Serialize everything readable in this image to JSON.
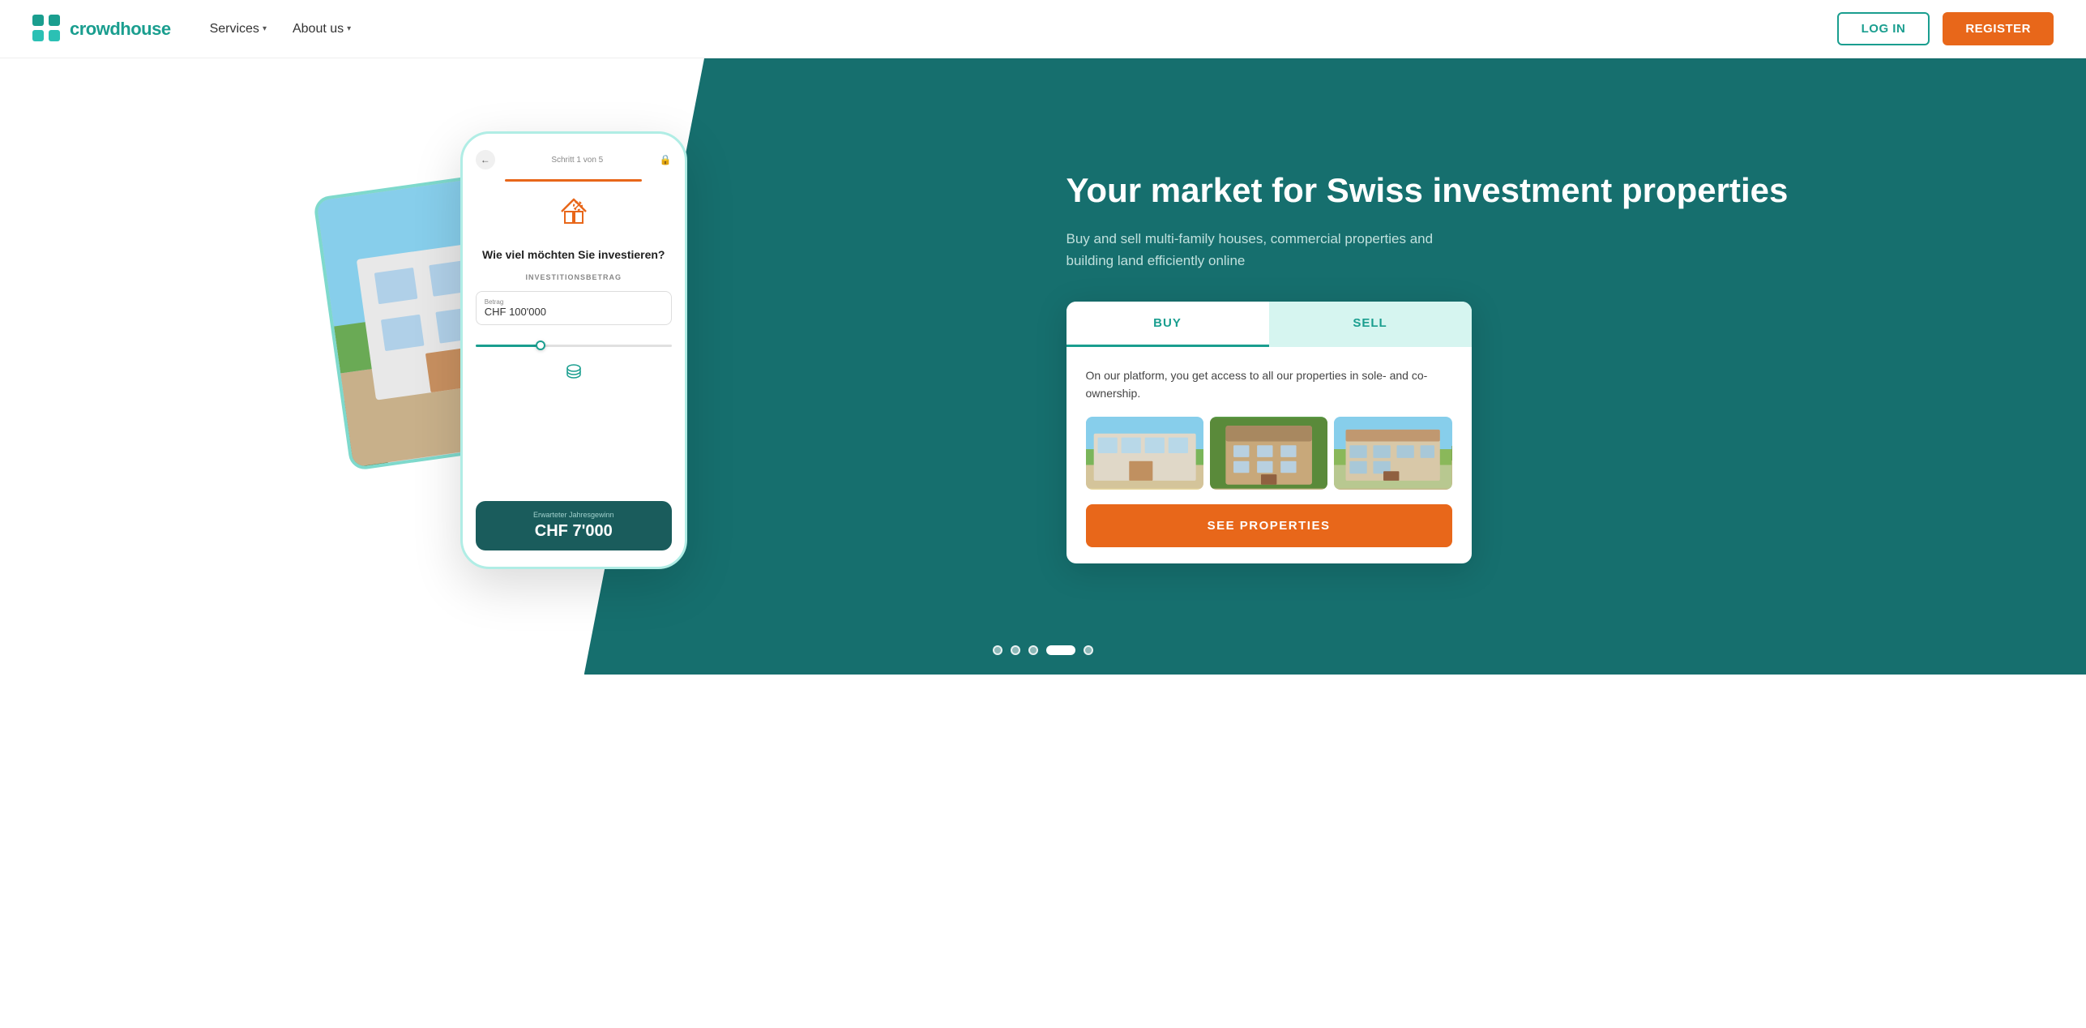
{
  "navbar": {
    "logo_text": "crowdhouse",
    "nav_items": [
      {
        "label": "Services",
        "has_dropdown": true
      },
      {
        "label": "About us",
        "has_dropdown": true
      }
    ],
    "login_label": "LOG IN",
    "register_label": "REGISTER"
  },
  "hero": {
    "title": "Your market for Swiss investment properties",
    "subtitle": "Buy and sell multi-family houses, commercial properties and building land efficiently online",
    "phone": {
      "step_text": "Schritt 1 von 5",
      "question": "Wie viel möchten Sie investieren?",
      "label": "INVESTITIONSBETRAG",
      "input_label": "Betrag",
      "input_value": "CHF 100'000",
      "result_label": "Erwarteter Jahresgewinn",
      "result_value": "CHF 7'000"
    },
    "buy_tab": "BUY",
    "sell_tab": "SELL",
    "buy_desc": "On our platform, you get access to all our properties in sole- and co-ownership.",
    "see_properties_label": "SEE PROPERTIES"
  },
  "dots": {
    "count": 5,
    "active_index": 3
  }
}
